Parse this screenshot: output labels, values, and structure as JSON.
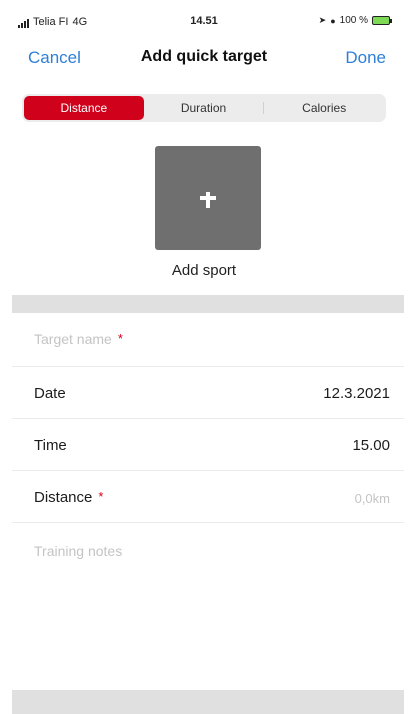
{
  "status_bar": {
    "carrier": "Telia FI",
    "network": "4G",
    "time": "14.51",
    "battery_percent": "100 %",
    "battery_color": "#7ed957"
  },
  "nav": {
    "cancel_label": "Cancel",
    "title": "Add quick target",
    "done_label": "Done",
    "accent_color": "#2f80d6"
  },
  "segments": {
    "selected": "Distance",
    "items": [
      {
        "label": "Distance"
      },
      {
        "label": "Duration"
      },
      {
        "label": "Calories"
      }
    ],
    "active_color": "#d0021b"
  },
  "add_sport": {
    "icon": "plus-icon",
    "label": "Add sport"
  },
  "form": {
    "target_name": {
      "placeholder": "Target name",
      "required_mark": "*"
    },
    "date": {
      "label": "Date",
      "value": "12.3.2021"
    },
    "time": {
      "label": "Time",
      "value": "15.00"
    },
    "distance": {
      "label": "Distance",
      "required_mark": "*",
      "placeholder": "0,0km"
    },
    "training_notes": {
      "placeholder": "Training notes"
    }
  }
}
